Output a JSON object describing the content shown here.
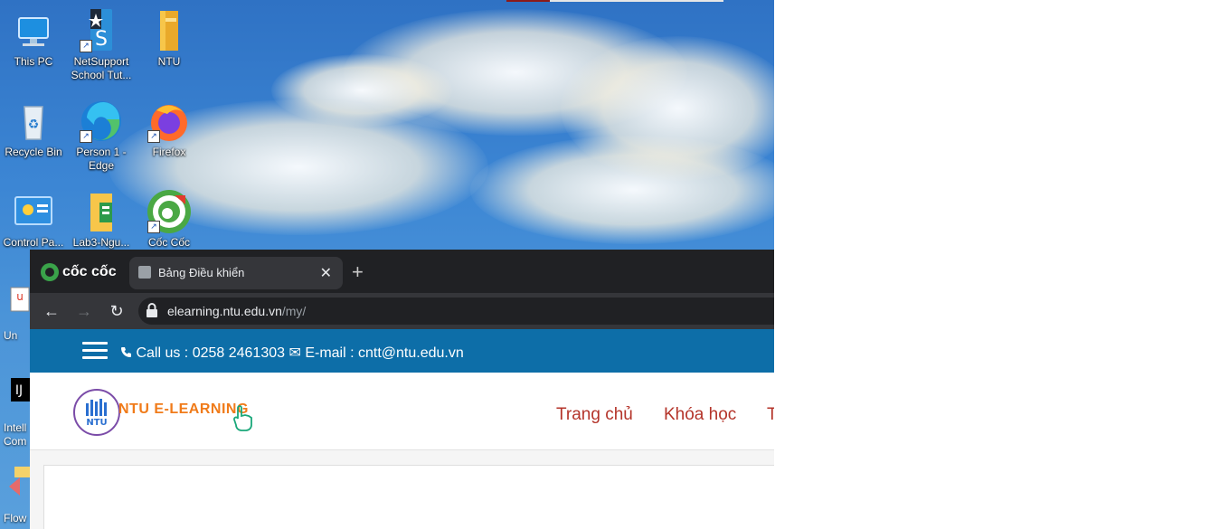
{
  "desktop": {
    "icons": [
      {
        "label": "This PC"
      },
      {
        "label": "NetSupport School Tut..."
      },
      {
        "label": "NTU"
      },
      {
        "label": "Recycle Bin"
      },
      {
        "label": "Person 1 - Edge"
      },
      {
        "label": "Firefox"
      },
      {
        "label": "Control Pa..."
      },
      {
        "label": "Lab3-Ngu..."
      },
      {
        "label": "Cốc Cốc"
      }
    ],
    "left_strip": [
      {
        "label": "Un"
      },
      {
        "label": "Intell Com"
      },
      {
        "label": "Flow"
      }
    ]
  },
  "browser": {
    "brand": "cốc cốc",
    "tab": {
      "title": "Bảng Điều khiển",
      "close": "✕"
    },
    "new_tab": "+",
    "nav": {
      "back": "←",
      "forward": "→",
      "reload": "↻"
    },
    "address": {
      "host": "elearning.ntu.edu.vn",
      "path": "/my/"
    }
  },
  "page": {
    "contact": "Call us : 0258 2461303 ✉ E-mail : cntt@ntu.edu.vn",
    "phone_icon": "phone-icon",
    "logo_text": "NTU E-LEARNING",
    "logo_circle_text": "NTU",
    "menu": [
      {
        "label": "Trang chủ"
      },
      {
        "label": "Khóa học"
      },
      {
        "label": "T"
      }
    ],
    "colors": {
      "header": "#0d6ea8",
      "menu": "#b4342a",
      "logo": "#f07b1a"
    }
  }
}
